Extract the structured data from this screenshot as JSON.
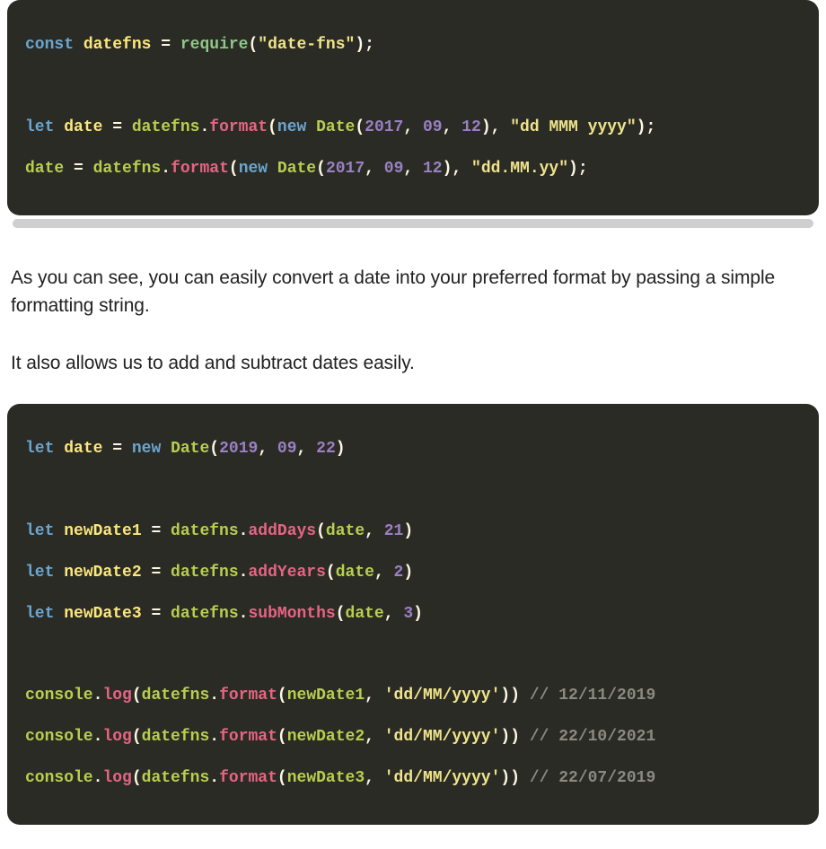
{
  "prose": {
    "p1": "As you can see, you can easily convert a date into your preferred format by passing a simple formatting string.",
    "p2": "It also allows us to add and subtract dates easily."
  },
  "code1": {
    "l1": {
      "kw_const": "const",
      "var": "datefns",
      "eq": " = ",
      "require": "require",
      "lp": "(",
      "arg": "\"date-fns\"",
      "rp": ")",
      "semi": ";"
    },
    "blank1": "",
    "l2": {
      "kw_let": "let",
      "var": "date",
      "eq": " = ",
      "obj": "datefns",
      "dot1": ".",
      "fn": "format",
      "lp": "(",
      "kw_new": "new",
      "cls": "Date",
      "lp2": "(",
      "y": "2017",
      "c1": ",",
      "m": " 09",
      "c2": ",",
      "d": " 12",
      "rp2": ")",
      "c3": ",",
      "fmt": " \"dd MMM yyyy\"",
      "rp": ")",
      "semi": ";"
    },
    "l3": {
      "var": "date",
      "eq": " = ",
      "obj": "datefns",
      "dot1": ".",
      "fn": "format",
      "lp": "(",
      "kw_new": "new",
      "cls": "Date",
      "lp2": "(",
      "y": "2017",
      "c1": ",",
      "m": " 09",
      "c2": ",",
      "d": " 12",
      "rp2": ")",
      "c3": ",",
      "fmt": " \"dd.MM.yy\"",
      "rp": ")",
      "semi": ";"
    }
  },
  "code2": {
    "l1": {
      "kw_let": "let",
      "var": "date",
      "eq": " = ",
      "kw_new": "new",
      "cls": "Date",
      "lp": "(",
      "y": "2019",
      "c1": ",",
      "m": " 09",
      "c2": ",",
      "d": " 22",
      "rp": ")"
    },
    "blank1": "",
    "l2": {
      "kw_let": "let",
      "var": "newDate1",
      "eq": " = ",
      "obj": "datefns",
      "dot": ".",
      "fn": "addDays",
      "lp": "(",
      "arg1": "date",
      "c": ",",
      "arg2": " 21",
      "rp": ")"
    },
    "l3": {
      "kw_let": "let",
      "var": "newDate2",
      "eq": " = ",
      "obj": "datefns",
      "dot": ".",
      "fn": "addYears",
      "lp": "(",
      "arg1": "date",
      "c": ",",
      "arg2": " 2",
      "rp": ")"
    },
    "l4": {
      "kw_let": "let",
      "var": "newDate3",
      "eq": " = ",
      "obj": "datefns",
      "dot": ".",
      "fn": "subMonths",
      "lp": "(",
      "arg1": "date",
      "c": ",",
      "arg2": " 3",
      "rp": ")"
    },
    "blank2": "",
    "l5": {
      "obj": "console",
      "dot": ".",
      "fn": "log",
      "lp": "(",
      "obj2": "datefns",
      "dot2": ".",
      "fn2": "format",
      "lp2": "(",
      "arg": "newDate1",
      "c": ",",
      "fmt": " 'dd/MM/yyyy'",
      "rp2": ")",
      "rp": ")",
      "cmt": " // 12/11/2019"
    },
    "l6": {
      "obj": "console",
      "dot": ".",
      "fn": "log",
      "lp": "(",
      "obj2": "datefns",
      "dot2": ".",
      "fn2": "format",
      "lp2": "(",
      "arg": "newDate2",
      "c": ",",
      "fmt": " 'dd/MM/yyyy'",
      "rp2": ")",
      "rp": ")",
      "cmt": " // 22/10/2021"
    },
    "l7": {
      "obj": "console",
      "dot": ".",
      "fn": "log",
      "lp": "(",
      "obj2": "datefns",
      "dot2": ".",
      "fn2": "format",
      "lp2": "(",
      "arg": "newDate3",
      "c": ",",
      "fmt": " 'dd/MM/yyyy'",
      "rp2": ")",
      "rp": ")",
      "cmt": " // 22/07/2019"
    }
  }
}
